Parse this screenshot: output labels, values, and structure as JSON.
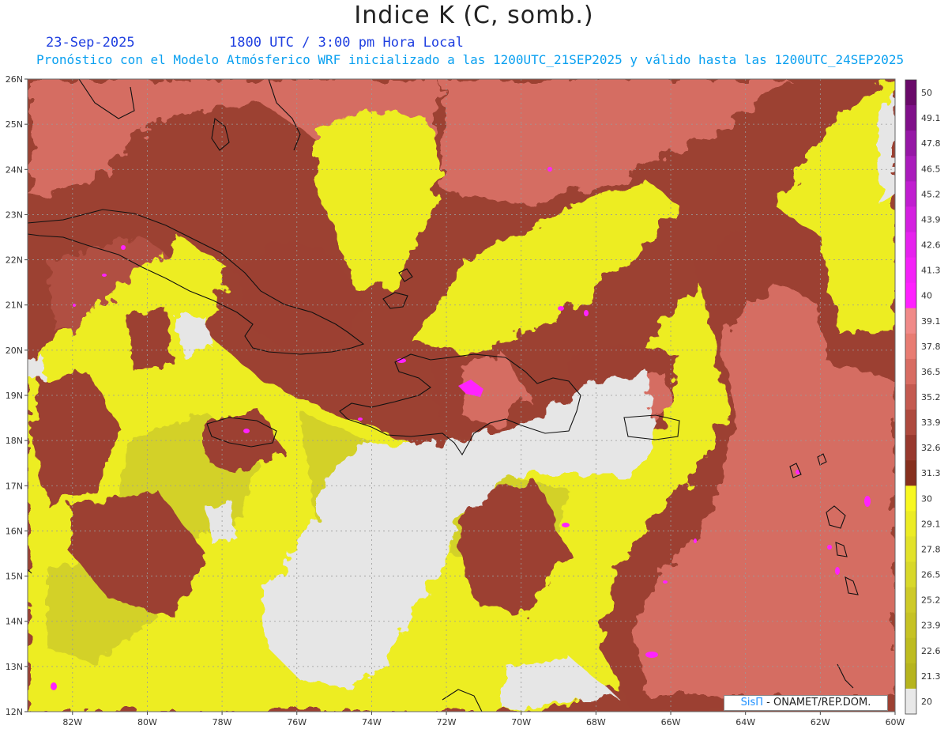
{
  "header": {
    "title": "Indice K (C, somb.)",
    "date": "23-Sep-2025",
    "time": "1800 UTC / 3:00 pm Hora Local",
    "subtitle": "Pronóstico con el Modelo Atmósferico WRF inicializado a las 1200UTC_21SEP2025 y válido hasta las  1200UTC_24SEP2025"
  },
  "credit": {
    "logo": "SisΠ",
    "text": "- ONAMET/REP.DOM."
  },
  "map": {
    "lat_labels": [
      "26N",
      "25N",
      "24N",
      "23N",
      "22N",
      "21N",
      "20N",
      "19N",
      "18N",
      "17N",
      "16N",
      "15N",
      "14N",
      "13N",
      "12N"
    ],
    "lon_labels": [
      "82W",
      "80W",
      "78W",
      "76W",
      "74W",
      "72W",
      "70W",
      "68W",
      "66W",
      "64W",
      "62W",
      "60W"
    ],
    "lat_range": [
      12,
      26
    ],
    "lon_range": [
      -83.2,
      -60
    ]
  },
  "colorbar": {
    "labels": [
      "50",
      "49.1",
      "47.8",
      "46.5",
      "45.2",
      "43.9",
      "42.6",
      "41.3",
      "40",
      "39.1",
      "37.8",
      "36.5",
      "35.2",
      "33.9",
      "32.6",
      "31.3",
      "30",
      "29.1",
      "27.8",
      "26.5",
      "25.2",
      "23.9",
      "22.6",
      "21.3",
      "20"
    ],
    "colors": [
      "#6a0a6a",
      "#80108a",
      "#9618a6",
      "#aa1cbc",
      "#c01ed0",
      "#d420e0",
      "#e622ee",
      "#f422f8",
      "#ff20ff",
      "#f08a88",
      "#e87c72",
      "#d86c62",
      "#c45a50",
      "#ae4a3e",
      "#98392e",
      "#86301e",
      "#f8f820",
      "#ecec24",
      "#e2e22a",
      "#d8d82a",
      "#ceca28",
      "#c6c224",
      "#bebc20",
      "#b6b41e",
      "#e8e8e8"
    ],
    "fills": {
      "light": "#e6e6e6",
      "yellow": "#eded22",
      "olive": "#cfcd2a",
      "brown": "#9c4132",
      "pink": "#d56d62",
      "magenta": "#ff22ff"
    }
  }
}
